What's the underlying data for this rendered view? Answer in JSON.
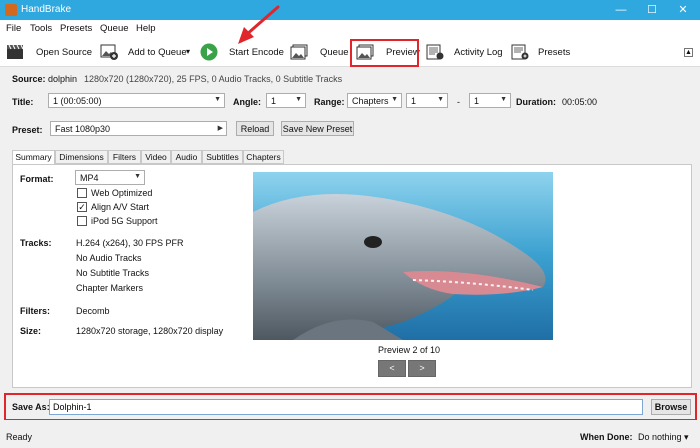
{
  "window": {
    "title": "HandBrake",
    "min": "—",
    "max": "☐",
    "close": "✕"
  },
  "menu": [
    "File",
    "Tools",
    "Presets",
    "Queue",
    "Help"
  ],
  "toolbar": {
    "open_source": "Open Source",
    "add_to_queue": "Add to Queue",
    "add_to_queue_arrow": "▾",
    "start_encode": "Start Encode",
    "queue": "Queue",
    "preview": "Preview",
    "activity_log": "Activity Log",
    "presets": "Presets"
  },
  "source": {
    "label": "Source:",
    "name": "dolphin",
    "details": "1280x720 (1280x720), 25 FPS, 0 Audio Tracks, 0 Subtitle Tracks"
  },
  "title_row": {
    "title_label": "Title:",
    "title_value": "1 (00:05:00)",
    "angle_label": "Angle:",
    "angle_value": "1",
    "range_label": "Range:",
    "range_type": "Chapters",
    "range_start": "1",
    "range_sep": "-",
    "range_end": "1",
    "duration_label": "Duration:",
    "duration_value": "00:05:00"
  },
  "preset": {
    "label": "Preset:",
    "value": "Fast 1080p30",
    "reload": "Reload",
    "save_new": "Save New Preset"
  },
  "tabs": [
    "Summary",
    "Dimensions",
    "Filters",
    "Video",
    "Audio",
    "Subtitles",
    "Chapters"
  ],
  "summary": {
    "format_label": "Format:",
    "format_value": "MP4",
    "web_optimized": {
      "label": "Web Optimized",
      "checked": false
    },
    "align_av": {
      "label": "Align A/V Start",
      "checked": true
    },
    "ipod": {
      "label": "iPod 5G Support",
      "checked": false
    },
    "tracks_label": "Tracks:",
    "tracks": [
      "H.264 (x264), 30 FPS PFR",
      "No Audio Tracks",
      "No Subtitle Tracks",
      "Chapter Markers"
    ],
    "filters_label": "Filters:",
    "filters_value": "Decomb",
    "size_label": "Size:",
    "size_value": "1280x720 storage, 1280x720 display",
    "preview_caption": "Preview 2 of 10",
    "prev_btn": "<",
    "next_btn": ">"
  },
  "save": {
    "label": "Save As:",
    "value": "Dolphin-1",
    "browse": "Browse"
  },
  "status": {
    "text": "Ready",
    "when_done_label": "When Done:",
    "when_done_value": "Do nothing ▾"
  },
  "colors": {
    "titlebar": "#2ea8de",
    "highlight": "#e0262b",
    "play": "#3aa34a"
  }
}
